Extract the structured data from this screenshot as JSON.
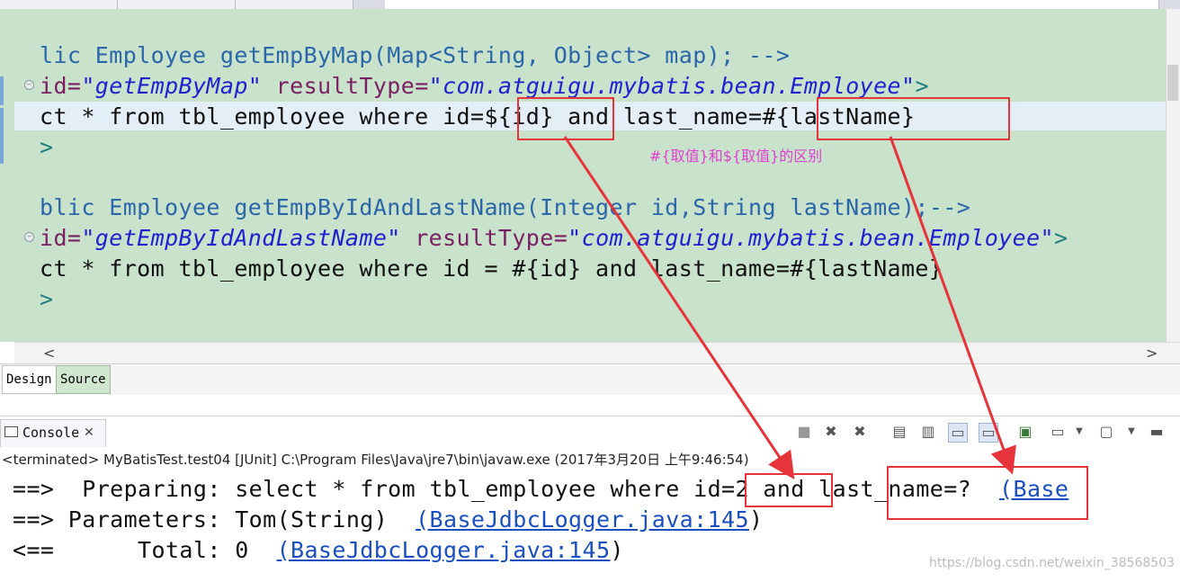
{
  "editor": {
    "lines": [
      {
        "t1": "lic Employee getEmpByMap(Map<String, Object> map); -->"
      },
      {
        "a1": "id=",
        "s1": "\"getEmpByMap\"",
        "a2": " resultType=",
        "s2": "\"com.atguigu.mybatis.bean.Employee\"",
        "t2": ">"
      },
      {
        "t1": "ct * from tbl_employee where id=${id} and last_name=#{lastName}"
      },
      {
        "t1": ">"
      },
      {
        "t1": ""
      },
      {
        "t1": "blic Employee getEmpByIdAndLastName(Integer id,String lastName);-->"
      },
      {
        "a1": "id=",
        "s1": "\"getEmpByIdAndLastName\"",
        "a2": " resultType=",
        "s2": "\"com.atguigu.mybatis.bean.Employee\"",
        "t2": ">"
      },
      {
        "t1": "ct * from tbl_employee where id = #{id} and last_name=#{lastName}"
      },
      {
        "t1": ">"
      }
    ],
    "hscroll_left": "<",
    "hscroll_right": ">"
  },
  "annotation": "#{取值}和${取值}的区别",
  "bottom_tabs": {
    "design": "Design",
    "source": "Source"
  },
  "console": {
    "tab_label": "Console",
    "close_icon_glyph": "✕",
    "terminated_line": "<terminated> MyBatisTest.test04 [JUnit] C:\\Program Files\\Java\\jre7\\bin\\javaw.exe (2017年3月20日 上午9:46:54)",
    "line1_prefix": "==>  Preparing: select * from tbl_employee where id=2 and last_name=?  ",
    "line1_link": "(Base",
    "line2_prefix": "==> Parameters: Tom(String)  ",
    "line2_link": "(BaseJdbcLogger.java:145",
    "line2_suffix": ")",
    "line3_prefix": "<==      Total: 0  ",
    "line3_link": "(BaseJdbcLogger.java:145",
    "line3_suffix": ")"
  },
  "toolbar_icons": [
    "stop-icon",
    "remove-launch-icon",
    "remove-all-icon",
    "scroll-lock-icon",
    "clear-console-icon",
    "pin-console-icon",
    "word-wrap-icon",
    "display-console-icon",
    "open-console-icon",
    "minimize-icon"
  ],
  "watermark": "https://blog.csdn.net/weixin_38568503",
  "colors": {
    "editor_bg": "#c8e2cb",
    "highlight_line": "#e4eef7",
    "annotation": "#e040d0",
    "red": "#e6343a",
    "link": "#1a4fbf"
  }
}
